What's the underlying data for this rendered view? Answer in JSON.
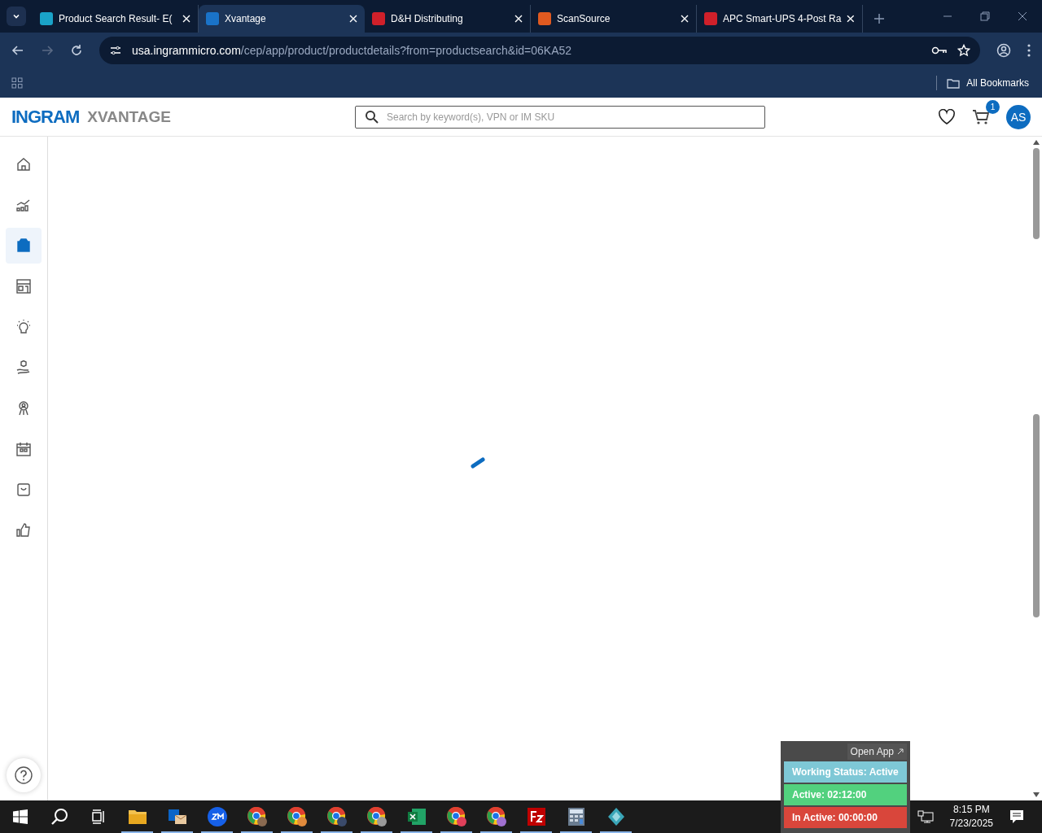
{
  "browser": {
    "tabs": [
      {
        "title": "Product Search Result- E(",
        "selected": false
      },
      {
        "title": "Xvantage",
        "selected": true
      },
      {
        "title": "D&H Distributing",
        "selected": false
      },
      {
        "title": "ScanSource",
        "selected": false
      },
      {
        "title": "APC Smart-UPS 4-Post Ra",
        "selected": false
      }
    ],
    "address": {
      "domain": "usa.ingrammicro.com",
      "path": "/cep/app/product/productdetails?from=productsearch&id=06KA52"
    },
    "bookmarks": "All Bookmarks"
  },
  "site": {
    "logo": "INGRAM",
    "product": "XVANTAGE",
    "search": {
      "placeholder": "Search by keyword(s), VPN or IM SKU"
    },
    "cart_count": "1",
    "avatar": "AS"
  },
  "sidebar": {
    "items": [
      {
        "kind": "home",
        "selected": false
      },
      {
        "kind": "chart",
        "selected": false
      },
      {
        "kind": "box",
        "selected": true
      },
      {
        "kind": "store",
        "selected": false
      },
      {
        "kind": "bulb",
        "selected": false
      },
      {
        "kind": "hand",
        "selected": false
      },
      {
        "kind": "award",
        "selected": false
      },
      {
        "kind": "calendar",
        "selected": false
      },
      {
        "kind": "bag",
        "selected": false
      },
      {
        "kind": "thumb",
        "selected": false
      }
    ]
  },
  "widget": {
    "open_app": "Open App",
    "statuses": [
      {
        "label": "Working Status: Active",
        "color": "#7ec8d6"
      },
      {
        "label": "Active: 02:12:00",
        "color": "#52d17e"
      },
      {
        "label": "In Active: 00:00:00",
        "color": "#d9463b"
      }
    ]
  },
  "taskbar": {
    "apps": [
      {
        "kind": "folder"
      },
      {
        "kind": "mail"
      },
      {
        "kind": "zm"
      },
      {
        "kind": "browser",
        "color": "#8a6a50"
      },
      {
        "kind": "browser",
        "color": "#e08a3c"
      },
      {
        "kind": "browser",
        "color": "#3a4a6a"
      },
      {
        "kind": "browser",
        "color": "#9a9a9a"
      },
      {
        "kind": "sheet"
      },
      {
        "kind": "browser",
        "color": "#e0405a"
      },
      {
        "kind": "browser",
        "color": "#a070d0"
      },
      {
        "kind": "fz"
      },
      {
        "kind": "calc"
      },
      {
        "kind": "gem"
      }
    ],
    "time": "8:15 PM",
    "date": "7/23/2025"
  }
}
